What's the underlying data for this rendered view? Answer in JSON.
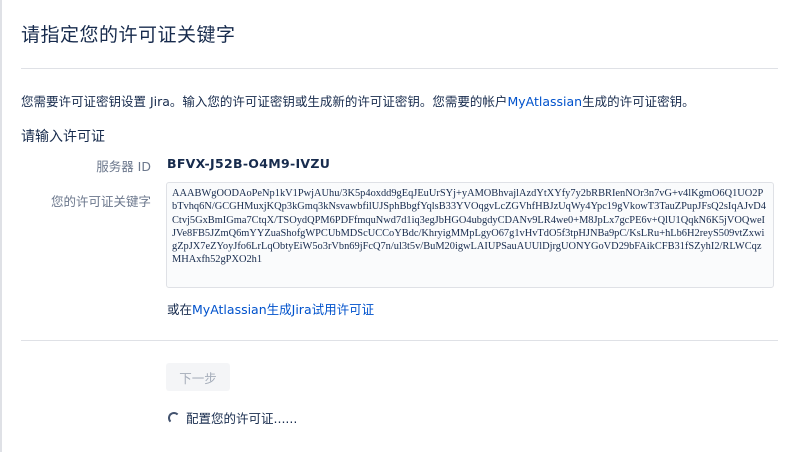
{
  "page": {
    "title": "请指定您的许可证关键字"
  },
  "intro": {
    "text_before": "您需要许可证密钥设置 Jira。输入您的许可证密钥或生成新的许可证密钥。您需要的帐户",
    "link_text": "MyAtlassian",
    "text_after": "生成的许可证密钥。"
  },
  "license_section": {
    "heading": "请输入许可证",
    "server_id_label": "服务器 ID",
    "server_id_value": "BFVX-J52B-O4M9-IVZU",
    "license_key_label": "您的许可证关键字",
    "license_key_value": "AAABWgOODAoPeNp1kV1PwjAUhu/3K5p4oxdd9gEqJEuUrSYj+yAMOBhvajlAzdYtXYfy7y2bRBRIenNOr3n7vG+v4lKgmO6Q1UO2PbTvhq6N/GCGHMuxjKQp3kGmq3kNsvawbfilUJSphBbgfYqlsB33YVOqgvLcZGVhfHBJzUqWy4Ypc19gVkowT3TauZPupJFsQ2sIqAJvD4Ctvj5GxBmIGma7CtqX/TSOydQPM6PDFfmquNwd7d1iq3egJbHGO4ubgdyCDANv9LR4we0+M8JpLx7gcPE6v+QlU1QqkN6K5jVOQweIJVe8FB5JZmQ6mYYZuaShofgWPCUbMDScUCCoYBdc/KhryigMMpLgyO67g1vHvTdO5f3tpHJNBa9pC/KsLRu+hLb6H2reyS509vtZxwigZpJX7eZYoyJfo6LrLqObtyEiW5o3rVbn69jFcQ7n/ul3t5v/BuM20igwLAIUPSauAUUlDjrgUONYGoVD29bFAikCFB31fSZyhI2/RLWCqzMHAxfh52gPXO2h1"
  },
  "generate_link": {
    "text_before": "或在",
    "link_text": "MyAtlassian生成Jira试用许可证"
  },
  "actions": {
    "next_label": "下一步",
    "status_text": "配置您的许可证......"
  }
}
